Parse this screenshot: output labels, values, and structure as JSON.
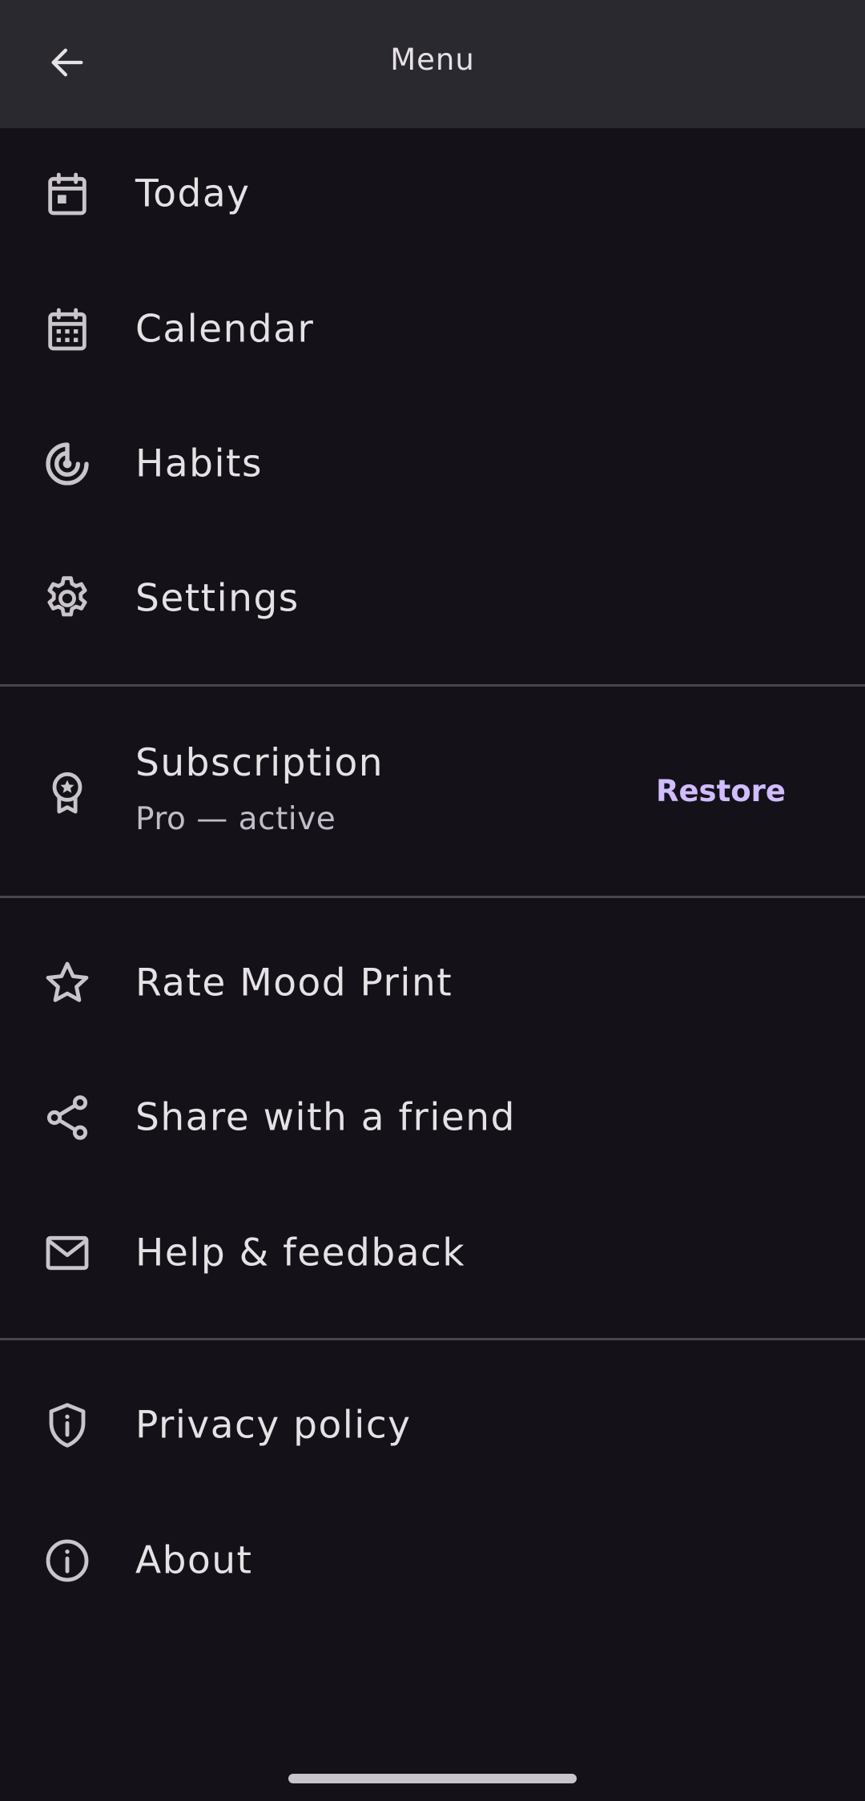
{
  "topbar": {
    "title": "Menu",
    "back_icon": "arrow-back-icon"
  },
  "nav_items": [
    {
      "label": "Today",
      "icon": "calendar-today-icon"
    },
    {
      "label": "Calendar",
      "icon": "calendar-month-icon"
    },
    {
      "label": "Habits",
      "icon": "habits-target-icon"
    },
    {
      "label": "Settings",
      "icon": "gear-icon"
    }
  ],
  "subscription": {
    "title": "Subscription",
    "status": "Pro — active",
    "action_label": "Restore",
    "icon": "award-badge-icon",
    "accent_color": "#d0bcff"
  },
  "support_items": [
    {
      "label": "Rate Mood Print",
      "icon": "star-icon"
    },
    {
      "label": "Share with a friend",
      "icon": "share-icon"
    },
    {
      "label": "Help & feedback",
      "icon": "mail-icon"
    }
  ],
  "info_items": [
    {
      "label": "Privacy policy",
      "icon": "privacy-shield-icon"
    },
    {
      "label": "About",
      "icon": "info-icon"
    }
  ],
  "colors": {
    "background": "#141218",
    "topbar": "#2b2930",
    "text": "#e6e1e5",
    "divider": "#49454f",
    "accent": "#d0bcff"
  }
}
